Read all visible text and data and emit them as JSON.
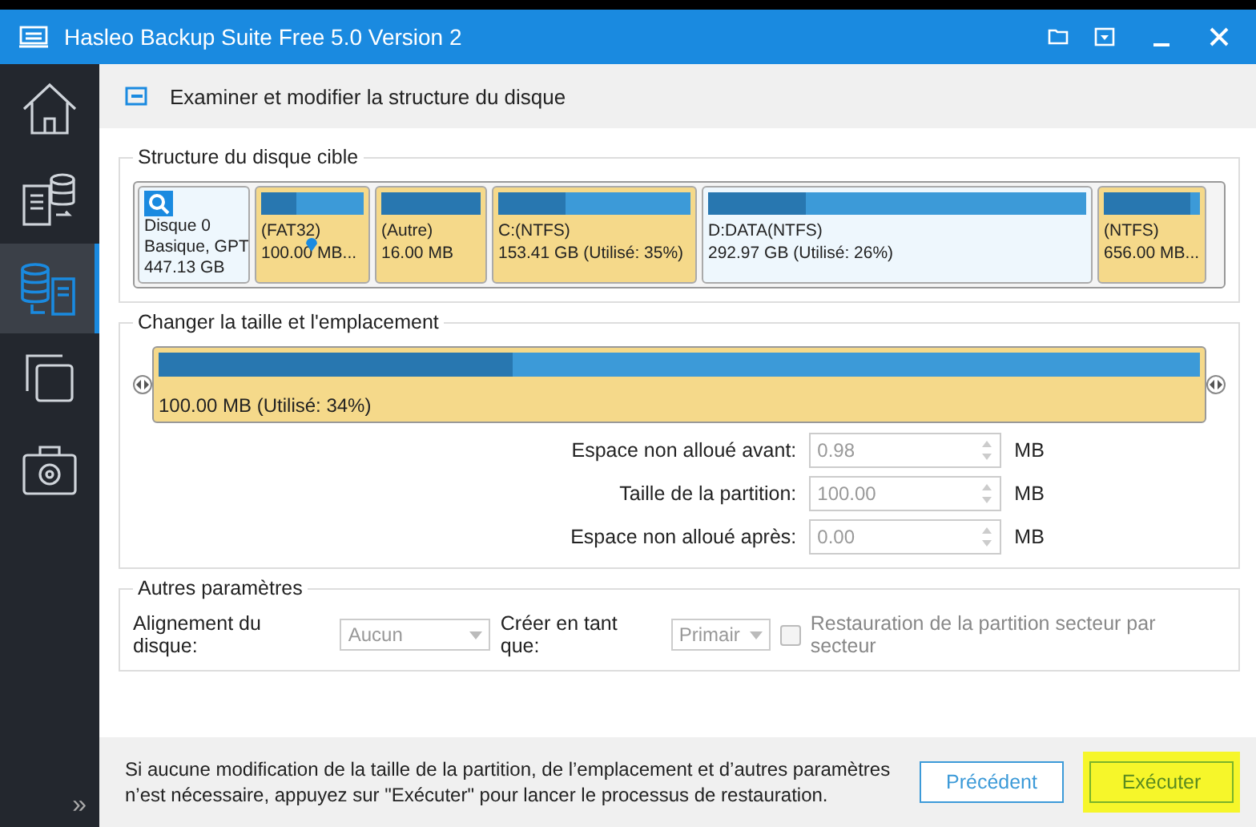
{
  "window": {
    "title": "Hasleo Backup Suite Free 5.0 Version 2"
  },
  "sidebar": {
    "items": [
      {
        "kind": "home",
        "selected": false
      },
      {
        "kind": "backup",
        "selected": false
      },
      {
        "kind": "restore",
        "selected": true
      },
      {
        "kind": "clone",
        "selected": false
      },
      {
        "kind": "tools",
        "selected": false
      }
    ],
    "expand": "»"
  },
  "page_title": "Examiner et modifier la structure du disque",
  "disk_structure": {
    "title": "Structure du disque cible",
    "disk": {
      "name": "Disque 0",
      "type": "Basique, GPT",
      "size": "447.13 GB"
    },
    "partitions": [
      {
        "label": "(FAT32)",
        "size": "100.00 MB...",
        "level": 0.34,
        "highlighted": true,
        "selected": true
      },
      {
        "label": "(Autre)",
        "size": "16.00 MB",
        "level": 1,
        "highlighted": true,
        "selected": false
      },
      {
        "label": "C:(NTFS)",
        "size": "153.41 GB (Utilisé: 35%)",
        "level": 0.35,
        "highlighted": true,
        "selected": false
      },
      {
        "label": "D:DATA(NTFS)",
        "size": "292.97 GB (Utilisé: 26%)",
        "level": 0.26,
        "highlighted": false,
        "selected": false
      },
      {
        "label": "(NTFS)",
        "size": "656.00 MB...",
        "level": 0.9,
        "highlighted": true,
        "selected": false
      }
    ]
  },
  "resize": {
    "title": "Changer la taille et l'emplacement",
    "bar": {
      "text": "100.00 MB (Utilisé: 34%)",
      "level": 0.34
    },
    "fields": [
      {
        "label": "Espace non alloué avant:",
        "value": "0.98",
        "unit": "MB"
      },
      {
        "label": "Taille de la partition:",
        "value": "100.00",
        "unit": "MB"
      },
      {
        "label": "Espace non alloué après:",
        "value": "0.00",
        "unit": "MB"
      }
    ]
  },
  "other": {
    "title": "Autres paramètres",
    "alignment": {
      "label": "Alignement du disque:",
      "value": "Aucun"
    },
    "create_as": {
      "label": "Créer en tant que:",
      "value": "Primair"
    },
    "sector": {
      "label": "Restauration de la partition secteur par secteur",
      "checked": false
    }
  },
  "footer": {
    "message": "Si aucune modification de la taille de la partition, de l’emplacement et d’autres paramètres n’est nécessaire, appuyez sur \"Exécuter\" pour lancer le processus de restauration.",
    "buttons": [
      {
        "label": "Précédent",
        "highlighted": false
      },
      {
        "label": "Exécuter",
        "highlighted": true
      }
    ]
  }
}
